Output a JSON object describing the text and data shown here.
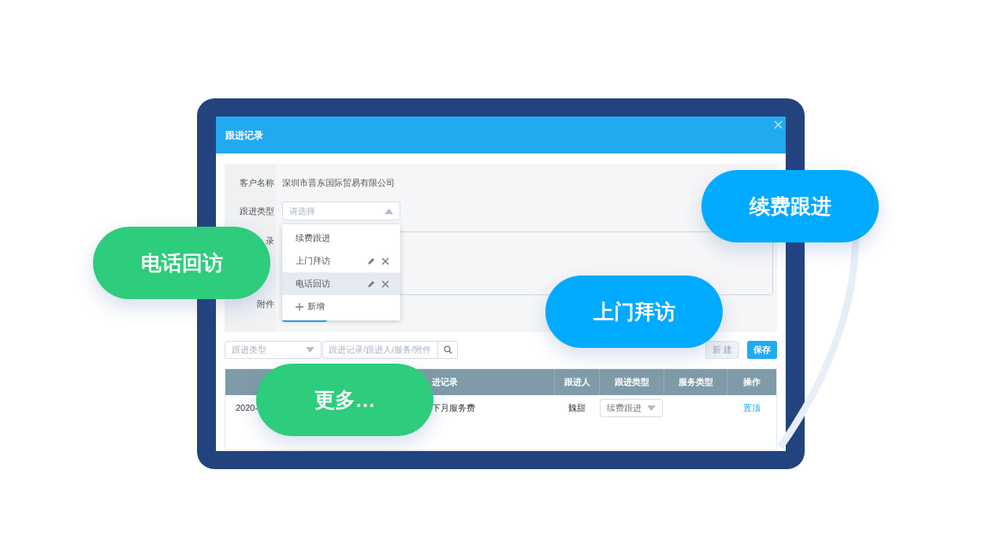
{
  "dialog": {
    "title": "跟进记录",
    "form": {
      "customer": {
        "label": "客户名称",
        "value": "深圳市晋东国际贸易有限公司"
      },
      "type": {
        "label": "跟进类型",
        "placeholder": "请选择",
        "expanded": true,
        "options": [
          {
            "label": "续费跟进",
            "editable": false,
            "selected": false
          },
          {
            "label": "上门拜访",
            "editable": true,
            "selected": false
          },
          {
            "label": "电话回访",
            "editable": true,
            "selected": true
          }
        ],
        "add_label": "新增"
      },
      "record": {
        "label": "录"
      },
      "attachment": {
        "label": "附件"
      }
    },
    "toolbar": {
      "type_filter": {
        "placeholder": "跟进类型"
      },
      "search": {
        "placeholder": "跟进记录/跟进人/服务/附件"
      },
      "buttons": [
        {
          "label": "新 建",
          "disabled": true
        },
        {
          "label": "保存",
          "disabled": false
        }
      ]
    },
    "table": {
      "columns": [
        "进记录",
        "跟进人",
        "跟进类型",
        "服务类型",
        "操作"
      ],
      "rows": [
        {
          "date": "2020-",
          "record": "下月服务费",
          "person": "魏甜",
          "type": "续费跟进",
          "action": "置顶"
        }
      ]
    }
  },
  "callouts": [
    {
      "label": "电话回访",
      "color": "#2ecc7d"
    },
    {
      "label": "续费跟进",
      "color": "#00aaff"
    },
    {
      "label": "上门拜访",
      "color": "#00aaff"
    },
    {
      "label": "更多…",
      "color": "#2ecc7d"
    }
  ]
}
